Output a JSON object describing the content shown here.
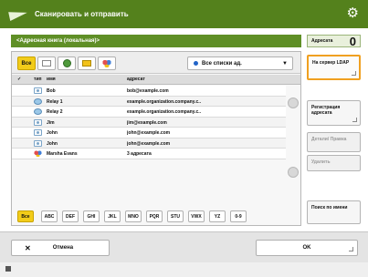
{
  "header": {
    "title": "Сканировать и отправить",
    "icon": "send-arrow-icon",
    "settings_icon": "gear-icon"
  },
  "address_bar": {
    "text": "<Адресная книга (локальная)>"
  },
  "destinations": {
    "label": "Адресата",
    "count": "0"
  },
  "toolbar": {
    "filters": [
      {
        "label": "Все",
        "icon": "all-icon",
        "active": true
      },
      {
        "label": "",
        "icon": "email-icon",
        "active": false
      },
      {
        "label": "",
        "icon": "network-icon",
        "active": false
      },
      {
        "label": "",
        "icon": "folder-icon",
        "active": false
      },
      {
        "label": "",
        "icon": "group-icon",
        "active": false
      }
    ],
    "list_select": "Все списки ад."
  },
  "list": {
    "columns": {
      "type": "тип",
      "name": "имя",
      "address": "адресат"
    },
    "rows": [
      {
        "icon": "person-icon",
        "name": "Bob",
        "address": "bob@example.com"
      },
      {
        "icon": "group-icon",
        "name": "Relay 1",
        "address": "example.organization.company.c.."
      },
      {
        "icon": "group-icon",
        "name": "Relay 2",
        "address": "example.organization.company.c.."
      },
      {
        "icon": "person-icon",
        "name": "Jim",
        "address": "jim@example.com"
      },
      {
        "icon": "person-icon",
        "name": "John",
        "address": "john@example.com"
      },
      {
        "icon": "person-icon",
        "name": "John",
        "address": "john@example.com"
      },
      {
        "icon": "multi-icon",
        "name": "Marsha Evans",
        "address": "3 адресата"
      }
    ]
  },
  "letters": [
    "Все",
    "ABC",
    "DEF",
    "GHI",
    "JKL",
    "MNO",
    "PQR",
    "STU",
    "VWX",
    "YZ",
    "0-9"
  ],
  "side": {
    "ldap": "На сервер LDAP",
    "register": "Регистрация адресата",
    "details": "Детали/ Правка",
    "delete": "Удалить",
    "search": "Поиск по имени"
  },
  "bottom": {
    "cancel": "Отмена",
    "ok": "OK"
  }
}
